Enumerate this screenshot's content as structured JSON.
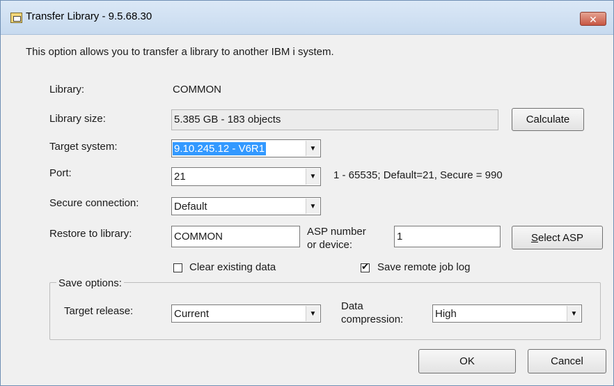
{
  "window": {
    "title": "Transfer Library - 9.5.68.30",
    "close_glyph": "✕"
  },
  "intro_text": "This option allows you to transfer a library to another IBM i system.",
  "library": {
    "label": "Library:",
    "value": "COMMON"
  },
  "library_size": {
    "label": "Library size:",
    "value": "5.385 GB    - 183 objects",
    "calculate_button": "Calculate"
  },
  "target_system": {
    "label": "Target system:",
    "value": "9.10.245.12 - V6R1"
  },
  "port": {
    "label": "Port:",
    "value": "21",
    "hint": "1 - 65535; Default=21, Secure = 990"
  },
  "secure_connection": {
    "label": "Secure connection:",
    "value": "Default"
  },
  "restore_to_library": {
    "label": "Restore to library:",
    "value": "COMMON",
    "asp_label_line1": "ASP number",
    "asp_label_line2": "or device:",
    "asp_value": "1",
    "select_asp_button": "Select ASP"
  },
  "clear_existing_data": {
    "label": "Clear existing data",
    "checked": false
  },
  "save_remote_job_log": {
    "label": "Save remote job log",
    "checked": true,
    "check_glyph": "✔"
  },
  "save_options": {
    "title": "Save options:",
    "target_release_label": "Target release:",
    "target_release_value": "Current",
    "data_compression_label_line1": "Data",
    "data_compression_label_line2": "compression:",
    "data_compression_value": "High"
  },
  "footer": {
    "ok_button": "OK",
    "cancel_button": "Cancel"
  },
  "icons": {
    "dropdown_arrow": "▼",
    "app_icon": "library-transfer-icon"
  },
  "colors": {
    "selection": "#3399ff",
    "titlebar": "#c7daef",
    "close_button": "#c75643"
  }
}
